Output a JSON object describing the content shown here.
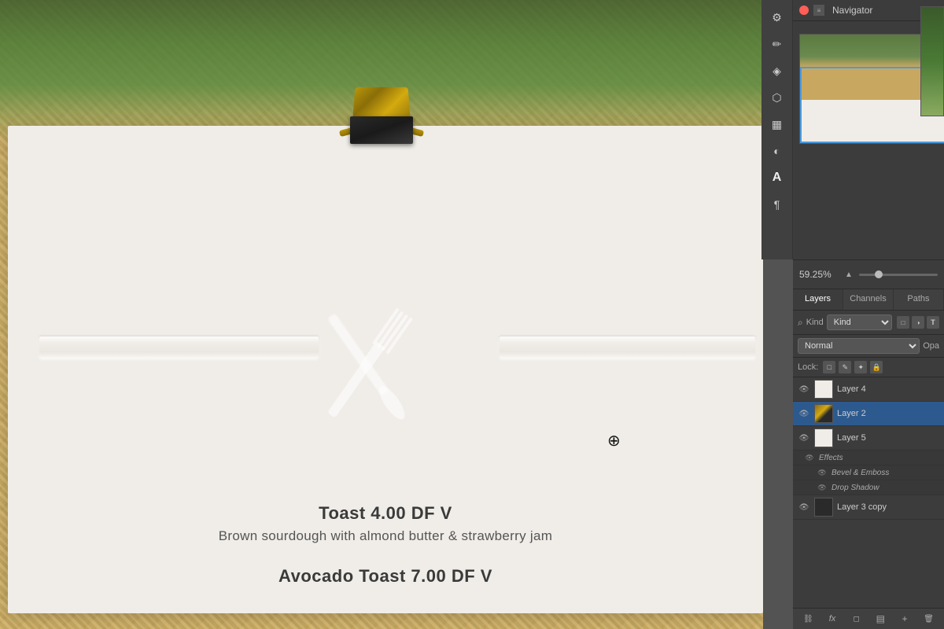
{
  "canvas": {
    "menu_item_1_title": "Toast  4.00  DF V",
    "menu_item_1_desc": "Brown sourdough with almond butter & strawberry jam",
    "menu_item_2_title": "Avocado Toast  7.00  DF V"
  },
  "navigator": {
    "title": "Navigator"
  },
  "zoom": {
    "value": "59.25%"
  },
  "layers_panel": {
    "tabs": [
      {
        "label": "Layers",
        "active": true
      },
      {
        "label": "Channels",
        "active": false
      },
      {
        "label": "Paths",
        "active": false
      }
    ],
    "filter_label": "Kind",
    "blend_mode": "Normal",
    "opacity_label": "Opa",
    "lock_label": "Lock:",
    "layers": [
      {
        "name": "Layer 4",
        "visible": true,
        "active": false,
        "thumb": "white"
      },
      {
        "name": "Layer 2",
        "visible": true,
        "active": true,
        "thumb": "photo"
      },
      {
        "name": "Layer 5",
        "visible": true,
        "active": false,
        "thumb": "white"
      },
      {
        "name": "Effects",
        "is_effects": true,
        "visible": true
      },
      {
        "name": "Bevel & Emboss",
        "is_effect": true,
        "visible": true
      },
      {
        "name": "Drop Shadow",
        "is_effect": true,
        "visible": true
      },
      {
        "name": "Layer 3 copy",
        "visible": true,
        "active": false,
        "thumb": "dark"
      }
    ]
  },
  "icons": {
    "close": "✕",
    "eye": "👁",
    "lock": "🔒",
    "move": "✦",
    "pixels": "□",
    "plus": "+",
    "fx": "fx",
    "chain": "⛓",
    "trash": "🗑",
    "new_layer": "□",
    "folder": "▶",
    "search": "⌕"
  }
}
